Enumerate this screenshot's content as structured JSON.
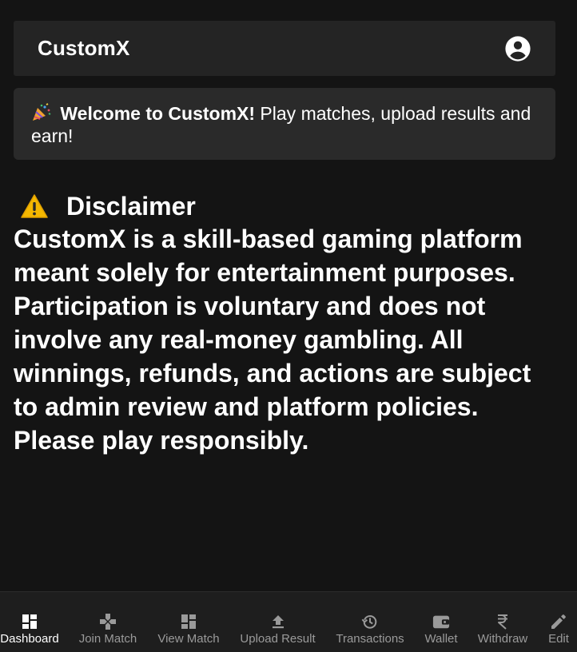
{
  "header": {
    "brand": "CustomX",
    "account_icon": "account-circle-icon"
  },
  "welcome": {
    "icon": "party-popper-icon",
    "bold": "Welcome to CustomX!",
    "text": " Play matches, upload results and earn!"
  },
  "disclaimer": {
    "icon": "warning-icon",
    "title": "Disclaimer",
    "body": "CustomX is a skill-based gaming platform meant solely for entertainment purposes. Participation is voluntary and does not involve any real-money gambling. All winnings, refunds, and actions are subject to admin review and platform policies. Please play responsibly."
  },
  "nav": {
    "active": "Dashboard",
    "items": [
      {
        "label": "Dashboard",
        "icon": "dashboard-icon"
      },
      {
        "label": "Join Match",
        "icon": "gamepad-icon"
      },
      {
        "label": "View Match",
        "icon": "grid-view-icon"
      },
      {
        "label": "Upload Result",
        "icon": "upload-icon"
      },
      {
        "label": "Transactions",
        "icon": "history-icon"
      },
      {
        "label": "Wallet",
        "icon": "wallet-icon"
      },
      {
        "label": "Withdraw",
        "icon": "rupee-icon"
      },
      {
        "label": "Edit",
        "icon": "pencil-icon"
      }
    ]
  },
  "colors": {
    "background": "#141414",
    "card": "#242424",
    "text": "#ffffff",
    "nav_inactive": "#9a9a9a"
  }
}
